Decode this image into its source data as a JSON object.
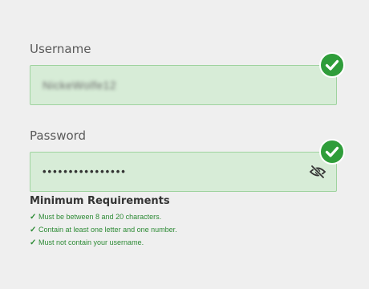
{
  "username": {
    "label": "Username",
    "value": "NickeWolfe12"
  },
  "password": {
    "label": "Password",
    "masked_value": "••••••••••••••••"
  },
  "requirements": {
    "title": "Minimum Requirements",
    "items": [
      "Must be between 8 and 20 characters.",
      "Contain at least one letter and one number.",
      "Must not contain your username."
    ]
  },
  "colors": {
    "valid_field_bg": "#d7ecd7",
    "valid_field_border": "#9fd39f",
    "success_green": "#2f9d3a",
    "requirement_text": "#2e8b36"
  },
  "icons": {
    "field_status": "check-circle-icon",
    "password_visibility": "eye-slash-icon",
    "requirement_status": "checkmark-icon"
  }
}
